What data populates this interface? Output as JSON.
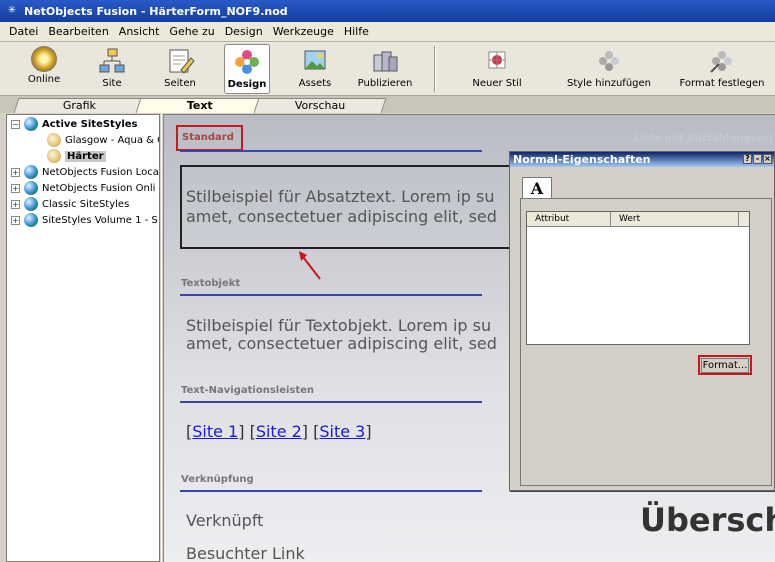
{
  "window": {
    "title": "NetObjects Fusion - HärterForm_NOF9.nod"
  },
  "menu": [
    "Datei",
    "Bearbeiten",
    "Ansicht",
    "Gehe zu",
    "Design",
    "Werkzeuge",
    "Hilfe"
  ],
  "toolbar": {
    "online": "Online",
    "site": "Site",
    "seiten": "Seiten",
    "design": "Design",
    "assets": "Assets",
    "publizieren": "Publizieren",
    "neuer_stil": "Neuer Stil",
    "style_hinzufuegen": "Style hinzufügen",
    "format_festlegen": "Format festlegen"
  },
  "tabs": [
    "Grafik",
    "Text",
    "Vorschau"
  ],
  "active_tab": "Text",
  "tree": {
    "active": "Active SiteStyles",
    "child1": "Glasgow - Aqua & G",
    "child2": "Härter",
    "item3": "NetObjects Fusion Loca",
    "item4": "NetObjects Fusion Onli",
    "item5": "Classic SiteStyles",
    "item6": "SiteStyles Volume 1 - S"
  },
  "canvas": {
    "standard_label": "Standard",
    "list_label": "Liste mit Aufzählungszei",
    "para_line1": "Stilbeispiel für Absatztext. Lorem ip su",
    "para_line2": "amet, consectetuer adipiscing elit, sed",
    "textobj_label": "Textobjekt",
    "textobj_line1": "Stilbeispiel für Textobjekt. Lorem ip su",
    "textobj_line2": "amet, consectetuer adipiscing elit, sed",
    "nav_label": "Text-Navigationsleisten",
    "nav_links": [
      "Site 1",
      "Site 2",
      "Site 3"
    ],
    "link_label": "Verknüpfung",
    "link_text": "Verknüpft",
    "visited_text": "Besuchter Link",
    "heading_text": "Übersch"
  },
  "dialog": {
    "title": "Normal-Eigenschaften",
    "tab": "A",
    "col_attribut": "Attribut",
    "col_wert": "Wert",
    "format_button": "Format..."
  },
  "colors": {
    "title_bar": "#2a5ac8",
    "rule": "#3b44a8",
    "highlight": "#c9171e",
    "link": "#1a1ae0"
  }
}
